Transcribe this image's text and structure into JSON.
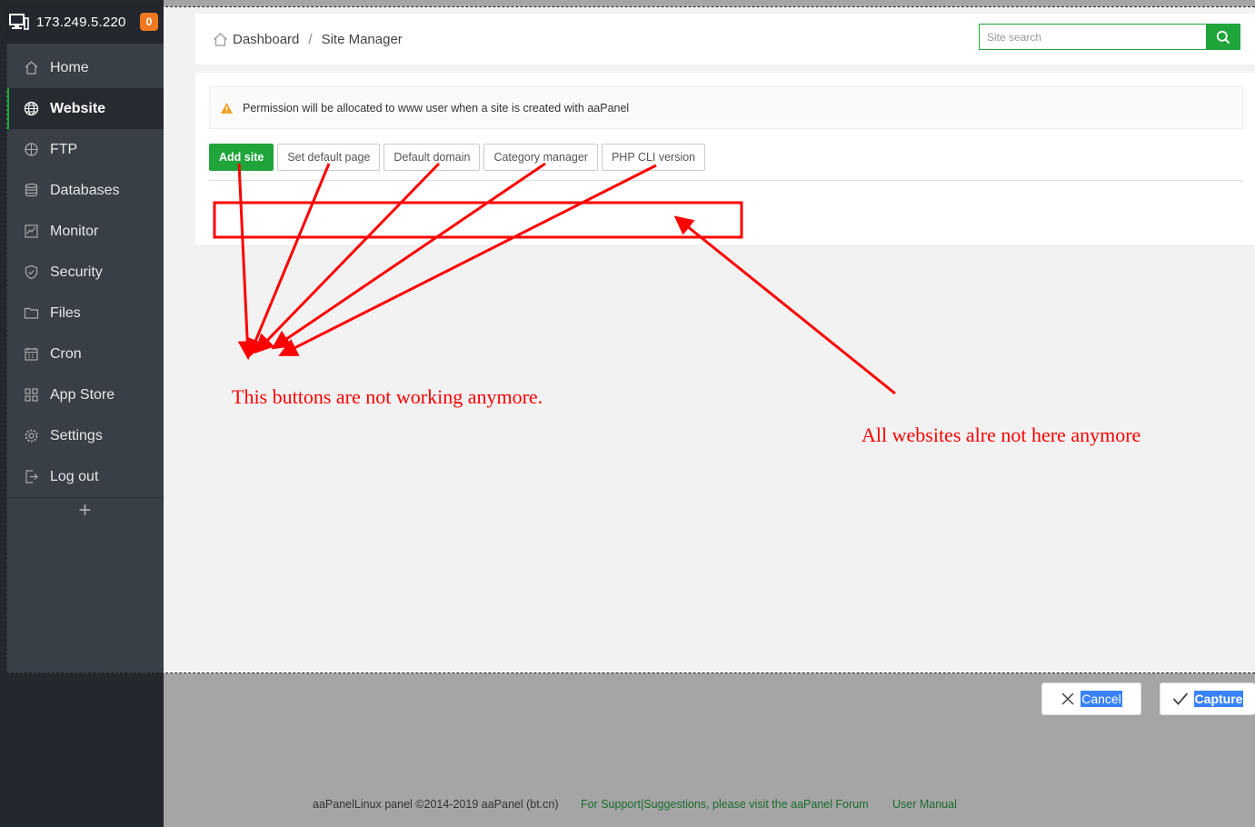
{
  "server": {
    "ip": "173.249.5.220",
    "notification_count": "0"
  },
  "sidebar": {
    "items": [
      {
        "label": "Home",
        "icon": "home-icon"
      },
      {
        "label": "Website",
        "icon": "globe-icon",
        "active": true
      },
      {
        "label": "FTP",
        "icon": "ftp-icon"
      },
      {
        "label": "Databases",
        "icon": "database-icon"
      },
      {
        "label": "Monitor",
        "icon": "monitor-icon"
      },
      {
        "label": "Security",
        "icon": "shield-icon"
      },
      {
        "label": "Files",
        "icon": "folder-icon"
      },
      {
        "label": "Cron",
        "icon": "calendar-icon"
      },
      {
        "label": "App Store",
        "icon": "grid-icon"
      },
      {
        "label": "Settings",
        "icon": "gear-icon"
      },
      {
        "label": "Log out",
        "icon": "logout-icon"
      }
    ],
    "add_label": "+"
  },
  "breadcrumb": {
    "home": "Dashboard",
    "separator": "/",
    "current": "Site Manager"
  },
  "search": {
    "placeholder": "Site search"
  },
  "notice": {
    "text": "Permission will be allocated to www user when a site is created with aaPanel"
  },
  "toolbar": {
    "add_site": "Add site",
    "set_default_page": "Set default page",
    "default_domain": "Default domain",
    "category_manager": "Category manager",
    "php_cli_version": "PHP CLI version"
  },
  "capture_bar": {
    "cancel": "Cancel",
    "capture": "Capture"
  },
  "footer": {
    "copyright": "aaPanelLinux panel ©2014-2019 aaPanel (bt.cn)",
    "support": "For Support|Suggestions, please visit the aaPanel Forum",
    "manual": "User Manual"
  },
  "annotations": {
    "buttons_note": "This buttons are not working anymore.",
    "sites_note": "All websites alre not here anymore"
  },
  "colors": {
    "brand_green": "#20a53a",
    "sidebar_bg": "#383f47",
    "badge_orange": "#f0781e",
    "annotation_red": "#ff0000"
  }
}
